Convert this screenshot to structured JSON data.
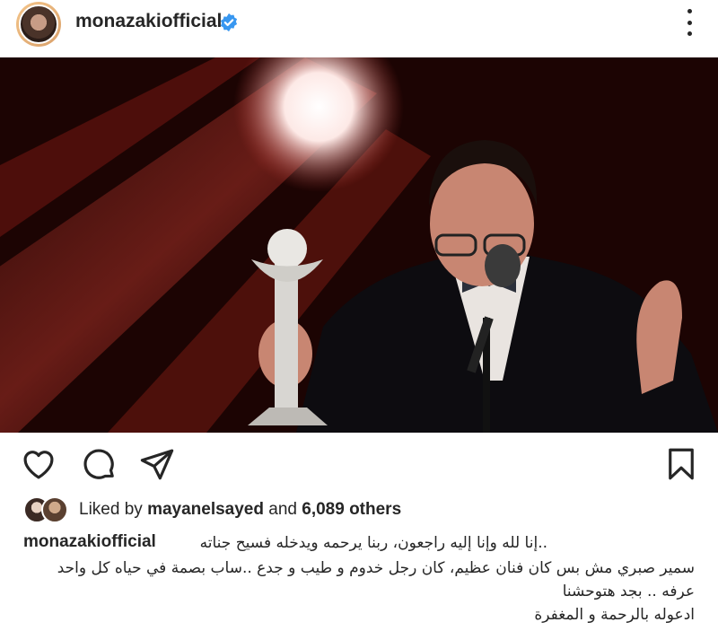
{
  "post": {
    "username": "monazakiofficial",
    "verified": true,
    "icons": {
      "avatar": "profile-avatar",
      "verified": "verified-badge-icon",
      "more": "more-options-icon",
      "like": "heart-icon",
      "comment": "comment-icon",
      "share": "send-icon",
      "save": "bookmark-icon"
    }
  },
  "likes": {
    "prefix": "Liked by",
    "user": "mayanelsayed",
    "and": "and",
    "others": "6,089 others"
  },
  "caption": {
    "username": "monazakiofficial",
    "line1_start": "..إنا لله وإنا إليه راجعون، ربنا يرحمه ويدخله فسيح جناته",
    "line2": "سمير صبري مش بس كان فنان عظيم، كان رجل خدوم و طيب و جدع ..ساب بصمة في حياه كل واحد",
    "line3": "عرفه .. بجد هتوحشنا",
    "line4": "ادعوله بالرحمة و المغفرة"
  },
  "colors": {
    "text": "#262626",
    "verified": "#3897f0",
    "photo_background": "#3a0a08"
  }
}
